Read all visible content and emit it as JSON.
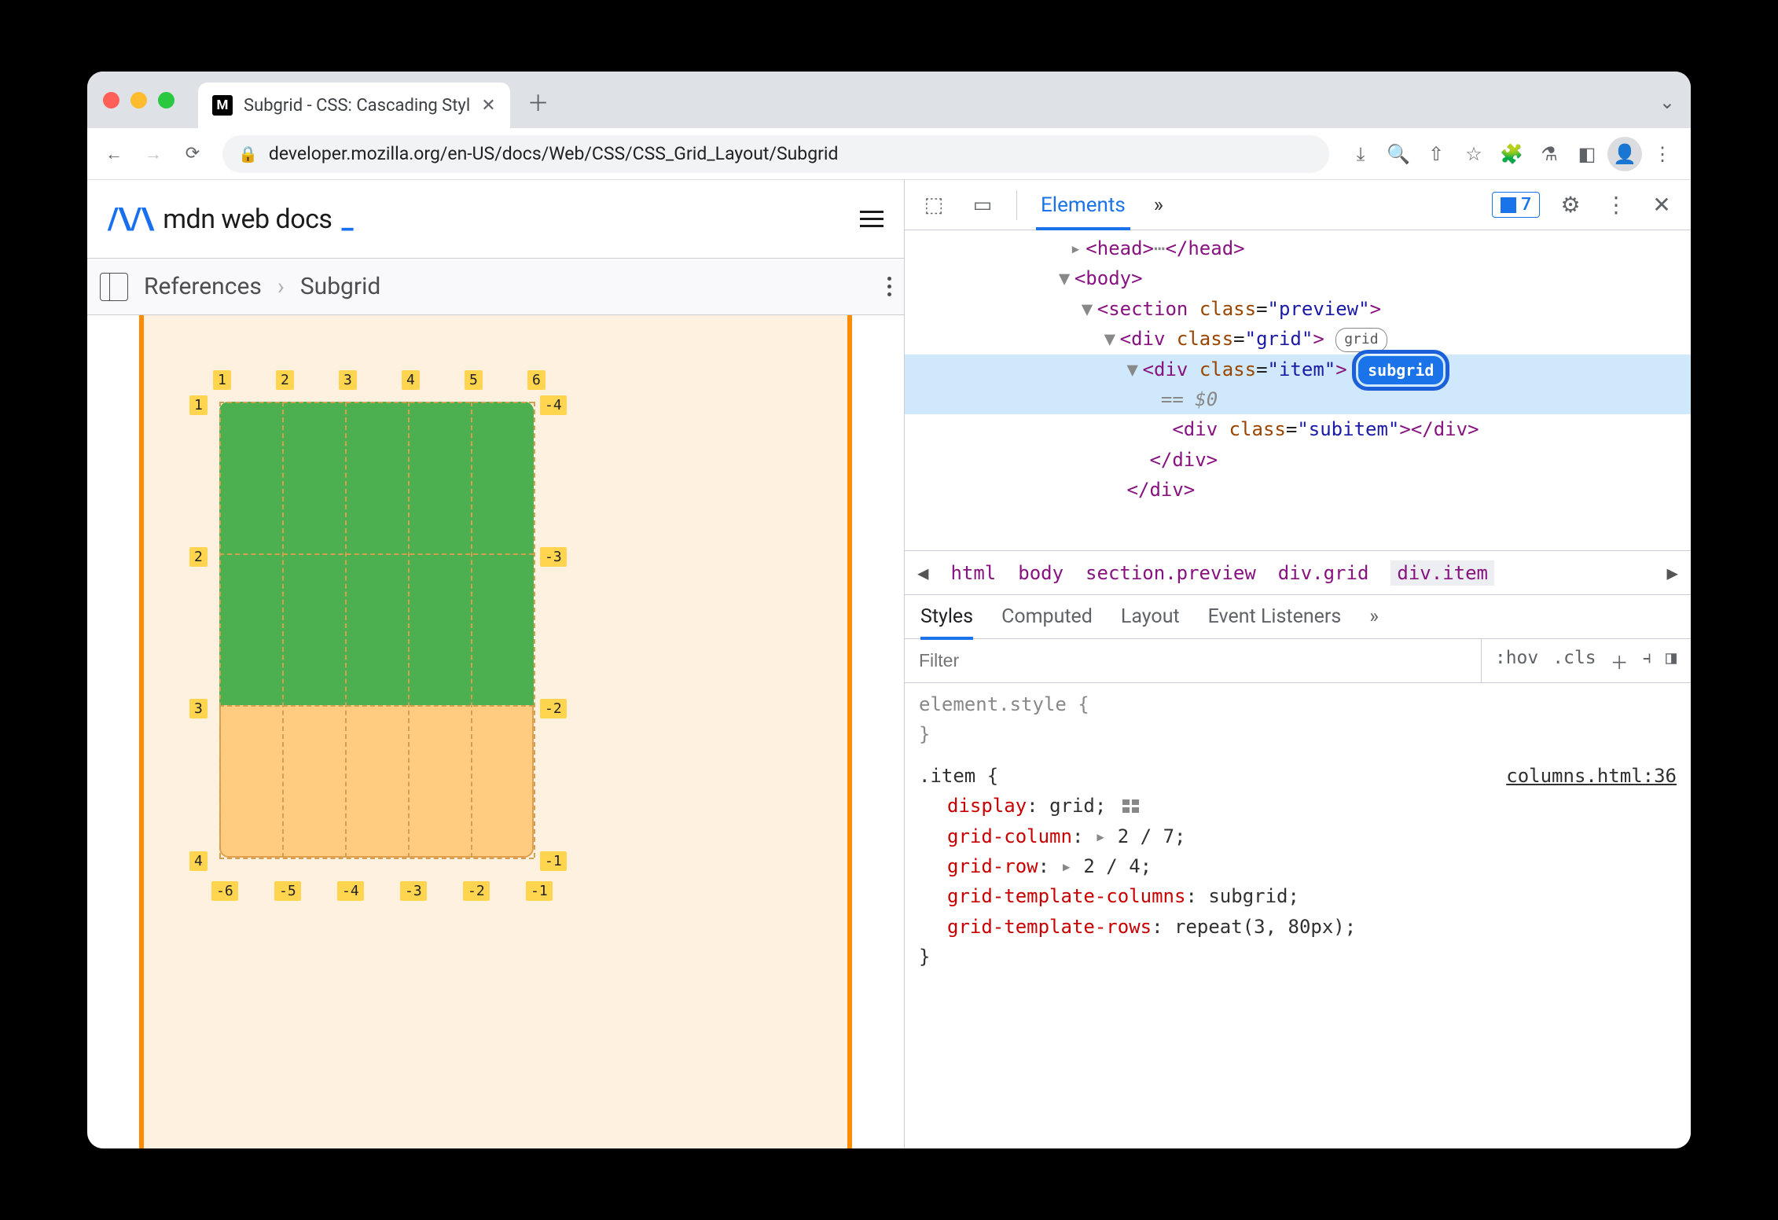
{
  "browser": {
    "tab_title": "Subgrid - CSS: Cascading Styl",
    "url_display": "developer.mozilla.org/en-US/docs/Web/CSS/CSS_Grid_Layout/Subgrid"
  },
  "mdn": {
    "logo_text": "mdn web docs",
    "breadcrumb": {
      "root": "References",
      "current": "Subgrid"
    }
  },
  "grid_demo": {
    "top_labels": [
      "1",
      "2",
      "3",
      "4",
      "5",
      "6"
    ],
    "left_labels": [
      "1",
      "2",
      "3",
      "4"
    ],
    "right_labels": [
      "-4",
      "-3",
      "-2",
      "-1"
    ],
    "bottom_labels": [
      "-6",
      "-5",
      "-4",
      "-3",
      "-2",
      "-1"
    ]
  },
  "devtools": {
    "panel": "Elements",
    "more": "»",
    "issues_count": "7",
    "dom": {
      "head_open": "<head>",
      "head_ell": "⋯",
      "head_close": "</head>",
      "body": "<body>",
      "section": {
        "tag": "section",
        "attr": "class",
        "val": "preview"
      },
      "div_grid": {
        "tag": "div",
        "attr": "class",
        "val": "grid",
        "badge": "grid"
      },
      "div_item": {
        "tag": "div",
        "attr": "class",
        "val": "item",
        "badge": "subgrid"
      },
      "eq0": "== $0",
      "subitem": {
        "tag": "div",
        "attr": "class",
        "val": "subitem"
      },
      "close_div1": "</div>",
      "close_div2": "</div>"
    },
    "path": [
      "html",
      "body",
      "section.preview",
      "div.grid",
      "div.item"
    ],
    "style_tabs": [
      "Styles",
      "Computed",
      "Layout",
      "Event Listeners",
      "»"
    ],
    "filter_placeholder": "Filter",
    "filter_right": [
      ":hov",
      ".cls"
    ],
    "element_style": "element.style {",
    "close_brace": "}",
    "rule": {
      "selector": ".item {",
      "source": "columns.html:36",
      "decls": [
        {
          "n": "display",
          "v": "grid",
          "icon": true
        },
        {
          "n": "grid-column",
          "v": "2 / 7",
          "tri": true
        },
        {
          "n": "grid-row",
          "v": "2 / 4",
          "tri": true
        },
        {
          "n": "grid-template-columns",
          "v": "subgrid"
        },
        {
          "n": "grid-template-rows",
          "v": "repeat(3, 80px)"
        }
      ]
    }
  }
}
